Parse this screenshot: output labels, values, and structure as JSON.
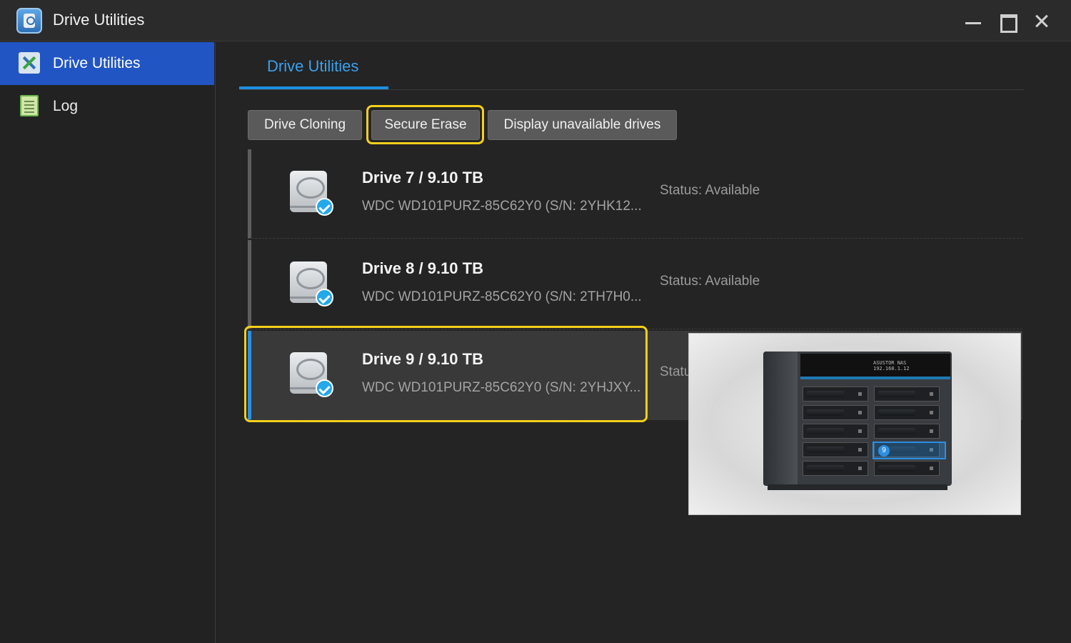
{
  "window": {
    "title": "Drive Utilities",
    "controls": [
      "minimize",
      "maximize",
      "close"
    ]
  },
  "sidebar": {
    "items": [
      {
        "label": "Drive Utilities",
        "icon": "tools-icon",
        "active": true
      },
      {
        "label": "Log",
        "icon": "log-icon",
        "active": false
      }
    ]
  },
  "main": {
    "tab": "Drive Utilities",
    "buttons": {
      "drive_cloning": "Drive Cloning",
      "secure_erase": "Secure Erase",
      "display_unavailable": "Display unavailable drives"
    },
    "drives": [
      {
        "name": "Drive 7 / 9.10 TB",
        "model": "WDC WD101PURZ-85C62Y0 (S/N: 2YHK12...",
        "status": "Status: Available",
        "selected": false
      },
      {
        "name": "Drive 8 / 9.10 TB",
        "model": "WDC WD101PURZ-85C62Y0 (S/N: 2TH7H0...",
        "status": "Status: Available",
        "selected": false
      },
      {
        "name": "Drive 9 / 9.10 TB",
        "model": "WDC WD101PURZ-85C62Y0 (S/N: 2YHJXY...",
        "status": "Status: Available",
        "selected": true
      }
    ],
    "preview": {
      "lcd_line1": "ASUSTOR NAS",
      "lcd_line2": "192.168.1.12",
      "highlighted_bay": "9"
    }
  },
  "colors": {
    "accent_blue": "#2155c4",
    "tab_blue": "#3aa0ee",
    "highlight_yellow": "#f5cf1a",
    "check_blue": "#23a9ea"
  }
}
